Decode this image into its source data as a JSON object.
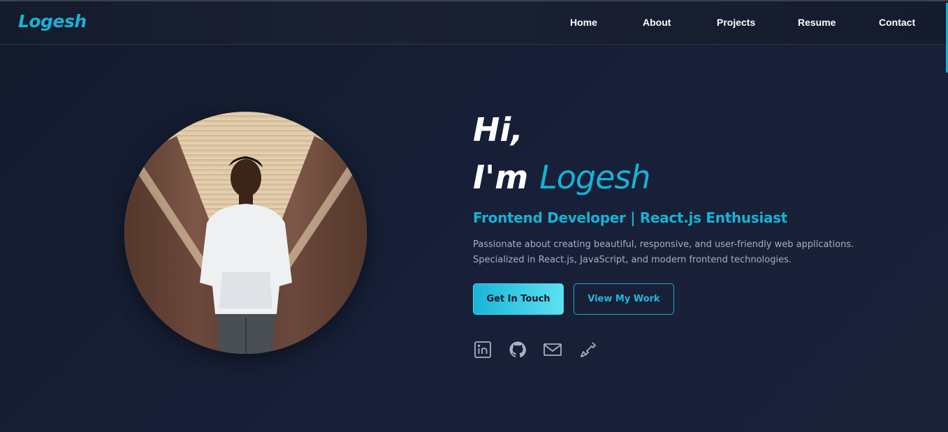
{
  "brand": {
    "logo_text": "Logesh",
    "accent_color": "#17b2d6"
  },
  "nav": {
    "items": [
      {
        "label": "Home"
      },
      {
        "label": "About"
      },
      {
        "label": "Projects"
      },
      {
        "label": "Resume"
      },
      {
        "label": "Contact"
      }
    ]
  },
  "hero": {
    "greeting": "Hi,",
    "intro_prefix": "I'm",
    "name": "Logesh",
    "subtitle": "Frontend Developer | React.js Enthusiast",
    "description": "Passionate about creating beautiful, responsive, and user-friendly web applications. Specialized in React.js, JavaScript, and modern frontend technologies.",
    "primary_button": "Get In Touch",
    "secondary_button": "View My Work",
    "socials": [
      {
        "icon": "linkedin-icon"
      },
      {
        "icon": "github-icon"
      },
      {
        "icon": "mail-icon"
      },
      {
        "icon": "phone-icon"
      }
    ]
  }
}
